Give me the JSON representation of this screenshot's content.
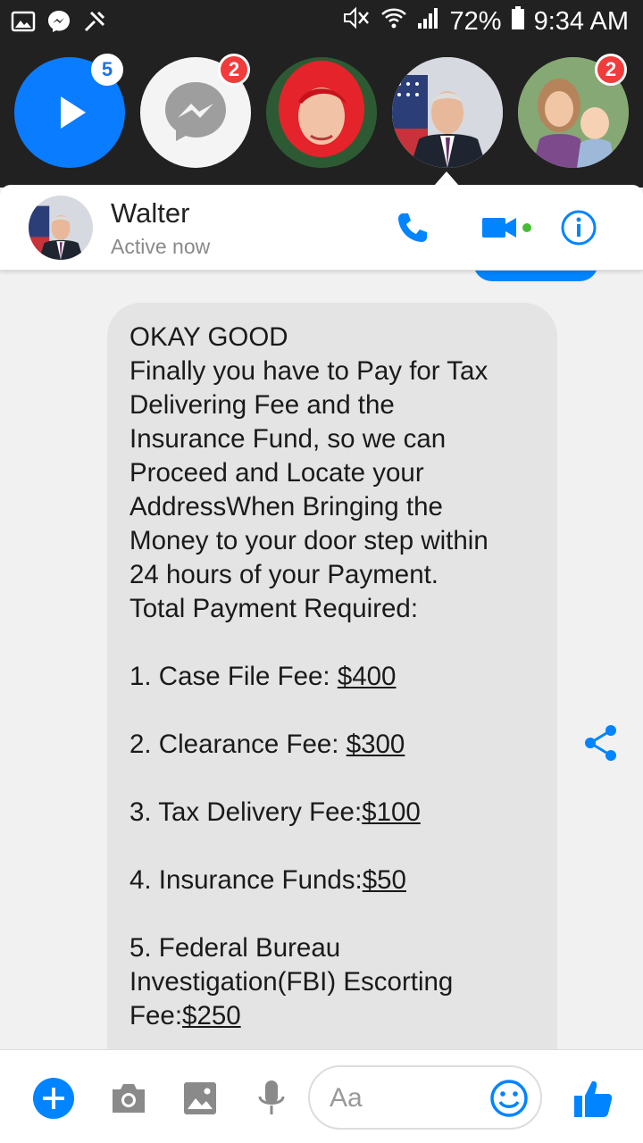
{
  "status_bar": {
    "battery_percent": "72%",
    "time": "9:34 AM",
    "icons": [
      "gallery-icon",
      "messenger-icon",
      "tools-icon",
      "mute-icon",
      "wifi-icon",
      "signal-icon",
      "battery-icon"
    ]
  },
  "chat_heads": [
    {
      "name": "play",
      "badge": "5"
    },
    {
      "name": "messenger",
      "badge": "2"
    },
    {
      "name": "red-hair-contact",
      "badge": ""
    },
    {
      "name": "walter",
      "badge": ""
    },
    {
      "name": "family-contact",
      "badge": "2"
    }
  ],
  "header": {
    "contact_name": "Walter",
    "status": "Active now",
    "icons": [
      "phone-icon",
      "video-icon",
      "info-icon"
    ],
    "accent_color": "#0084ff",
    "online_color": "#44bd32"
  },
  "message": {
    "lines": [
      "OKAY GOOD",
      "Finally you have to Pay for Tax",
      "Delivering Fee and the",
      "Insurance Fund, so we can",
      "Proceed and Locate your",
      "AddressWhen Bringing the",
      "Money to your door step within",
      "24 hours of your Payment.",
      "Total Payment Required:"
    ],
    "fees": [
      {
        "label": "1. Case File Fee: ",
        "amount": "$400"
      },
      {
        "label": "2. Clearance Fee: ",
        "amount": "$300"
      },
      {
        "label": "3. Tax Delivery Fee:",
        "amount": "$100"
      },
      {
        "label": "4. Insurance Funds:",
        "amount": "$50"
      }
    ],
    "fee5": {
      "line1": "5. Federal Bureau",
      "line2": "Investigation(FBI) Escorting",
      "label": "Fee:",
      "amount": "$250"
    }
  },
  "composer": {
    "placeholder": "Aa",
    "icons": [
      "plus-icon",
      "camera-icon",
      "image-icon",
      "mic-icon",
      "emoji-icon",
      "like-icon"
    ]
  }
}
